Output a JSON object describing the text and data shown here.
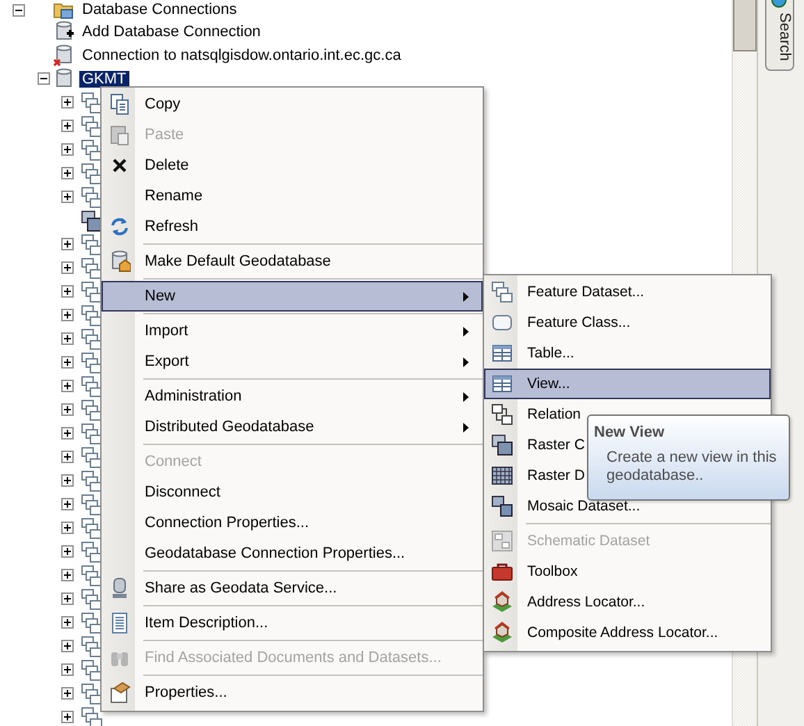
{
  "tree": {
    "root": {
      "label": "Database Connections",
      "expanded": true,
      "children": [
        {
          "kind": "add",
          "label": "Add Database Connection",
          "selected": false
        },
        {
          "kind": "broken",
          "label": "Connection to natsqlgisdow.ontario.int.ec.gc.ca",
          "selected": false
        },
        {
          "kind": "database",
          "label": "GKMT",
          "selected": true,
          "expanded": true,
          "children": [
            {
              "kind": "dataset",
              "expanded": false,
              "selected": false
            },
            {
              "kind": "dataset",
              "expanded": false,
              "selected": false
            },
            {
              "kind": "dataset",
              "expanded": false,
              "selected": false
            },
            {
              "kind": "dataset",
              "expanded": false,
              "selected": false
            },
            {
              "kind": "dataset",
              "expanded": false,
              "selected": false
            },
            {
              "kind": "raster",
              "selected": false
            },
            {
              "kind": "dataset",
              "expanded": false,
              "selected": false
            },
            {
              "kind": "dataset",
              "expanded": false,
              "selected": false
            },
            {
              "kind": "dataset",
              "expanded": false,
              "selected": false
            },
            {
              "kind": "dataset",
              "expanded": false,
              "selected": false
            },
            {
              "kind": "dataset",
              "expanded": false,
              "selected": false
            },
            {
              "kind": "dataset",
              "expanded": false,
              "selected": false
            },
            {
              "kind": "dataset",
              "expanded": false,
              "selected": false
            },
            {
              "kind": "dataset",
              "expanded": false,
              "selected": false
            },
            {
              "kind": "dataset",
              "expanded": false,
              "selected": false
            },
            {
              "kind": "dataset",
              "expanded": false,
              "selected": false
            },
            {
              "kind": "dataset",
              "expanded": false,
              "selected": false
            },
            {
              "kind": "dataset",
              "expanded": false,
              "selected": false
            },
            {
              "kind": "dataset",
              "expanded": false,
              "selected": false
            },
            {
              "kind": "dataset",
              "expanded": false,
              "selected": false
            },
            {
              "kind": "dataset",
              "expanded": false,
              "selected": false
            },
            {
              "kind": "dataset",
              "expanded": false,
              "selected": false
            },
            {
              "kind": "dataset",
              "expanded": false,
              "selected": false
            },
            {
              "kind": "dataset",
              "expanded": false,
              "selected": false
            },
            {
              "kind": "dataset",
              "expanded": false,
              "selected": false
            },
            {
              "kind": "dataset",
              "expanded": false,
              "selected": false
            },
            {
              "kind": "dataset",
              "expanded": false,
              "selected": false
            }
          ]
        }
      ]
    }
  },
  "context_menu": {
    "items": [
      {
        "kind": "item",
        "label": "Copy",
        "disabled": false,
        "selected": false,
        "submenu": false
      },
      {
        "kind": "item",
        "label": "Paste",
        "disabled": true,
        "selected": false,
        "submenu": false
      },
      {
        "kind": "item",
        "label": "Delete",
        "disabled": false,
        "selected": false,
        "submenu": false
      },
      {
        "kind": "item",
        "label": "Rename",
        "disabled": false,
        "selected": false,
        "submenu": false
      },
      {
        "kind": "item",
        "label": "Refresh",
        "disabled": false,
        "selected": false,
        "submenu": false
      },
      {
        "kind": "separator"
      },
      {
        "kind": "item",
        "label": "Make Default Geodatabase",
        "disabled": false,
        "selected": false,
        "submenu": false
      },
      {
        "kind": "separator"
      },
      {
        "kind": "item",
        "label": "New",
        "disabled": false,
        "selected": true,
        "submenu": true
      },
      {
        "kind": "separator"
      },
      {
        "kind": "item",
        "label": "Import",
        "disabled": false,
        "selected": false,
        "submenu": true
      },
      {
        "kind": "item",
        "label": "Export",
        "disabled": false,
        "selected": false,
        "submenu": true
      },
      {
        "kind": "separator"
      },
      {
        "kind": "item",
        "label": "Administration",
        "disabled": false,
        "selected": false,
        "submenu": true
      },
      {
        "kind": "item",
        "label": "Distributed Geodatabase",
        "disabled": false,
        "selected": false,
        "submenu": true
      },
      {
        "kind": "separator"
      },
      {
        "kind": "item",
        "label": "Connect",
        "disabled": true,
        "selected": false,
        "submenu": false
      },
      {
        "kind": "item",
        "label": "Disconnect",
        "disabled": false,
        "selected": false,
        "submenu": false
      },
      {
        "kind": "item",
        "label": "Connection Properties...",
        "disabled": false,
        "selected": false,
        "submenu": false
      },
      {
        "kind": "item",
        "label": "Geodatabase Connection Properties...",
        "disabled": false,
        "selected": false,
        "submenu": false
      },
      {
        "kind": "separator"
      },
      {
        "kind": "item",
        "label": "Share as Geodata Service...",
        "disabled": false,
        "selected": false,
        "submenu": false
      },
      {
        "kind": "separator"
      },
      {
        "kind": "item",
        "label": "Item Description...",
        "disabled": false,
        "selected": false,
        "submenu": false
      },
      {
        "kind": "separator"
      },
      {
        "kind": "item",
        "label": "Find Associated Documents and Datasets...",
        "disabled": true,
        "selected": false,
        "submenu": false
      },
      {
        "kind": "separator"
      },
      {
        "kind": "item",
        "label": "Properties...",
        "disabled": false,
        "selected": false,
        "submenu": false
      }
    ]
  },
  "submenu": {
    "items": [
      {
        "kind": "item",
        "label": "Feature Dataset...",
        "disabled": false,
        "selected": false
      },
      {
        "kind": "item",
        "label": "Feature Class...",
        "disabled": false,
        "selected": false
      },
      {
        "kind": "item",
        "label": "Table...",
        "disabled": false,
        "selected": false
      },
      {
        "kind": "item",
        "label": "View...",
        "disabled": false,
        "selected": true
      },
      {
        "kind": "item",
        "label": "Relation",
        "disabled": false,
        "selected": false
      },
      {
        "kind": "item",
        "label": "Raster C",
        "disabled": false,
        "selected": false
      },
      {
        "kind": "item",
        "label": "Raster D",
        "disabled": false,
        "selected": false
      },
      {
        "kind": "item",
        "label": "Mosaic Dataset...",
        "disabled": false,
        "selected": false
      },
      {
        "kind": "separator"
      },
      {
        "kind": "item",
        "label": "Schematic Dataset",
        "disabled": true,
        "selected": false
      },
      {
        "kind": "item",
        "label": "Toolbox",
        "disabled": false,
        "selected": false
      },
      {
        "kind": "item",
        "label": "Address Locator...",
        "disabled": false,
        "selected": false
      },
      {
        "kind": "item",
        "label": "Composite Address Locator...",
        "disabled": false,
        "selected": false
      }
    ]
  },
  "tooltip": {
    "title": "New View",
    "text": "Create a new view in this geodatabase.."
  },
  "side_panel": {
    "tabs": [
      {
        "label": "Search",
        "selected": false
      }
    ]
  }
}
